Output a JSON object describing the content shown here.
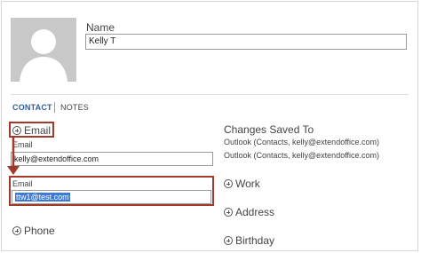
{
  "avatar": {
    "icon": "person-silhouette-icon",
    "background": "#c8c8c8"
  },
  "name": {
    "label": "Name",
    "value": "Kelly T"
  },
  "tabs": [
    {
      "label": "CONTACT",
      "active": true
    },
    {
      "label": "NOTES",
      "active": false
    }
  ],
  "email_section": {
    "add_label": "Email",
    "field1_label": "Email",
    "field1_value": "kelly@extendoffice.com",
    "field2_label": "Email",
    "field2_value": "ttw1@test.com"
  },
  "phone": {
    "add_label": "Phone"
  },
  "changes": {
    "title": "Changes Saved To",
    "lines": [
      "Outlook (Contacts, kelly@extendoffice.com)",
      "Outlook (Contacts, kelly@extendoffice.com)"
    ]
  },
  "right_sections": [
    {
      "label": "Work"
    },
    {
      "label": "Address"
    },
    {
      "label": "Birthday"
    }
  ],
  "colors": {
    "accent": "#2a5fa6",
    "annotation": "#a23a2a",
    "selection": "#3c7ad6"
  }
}
